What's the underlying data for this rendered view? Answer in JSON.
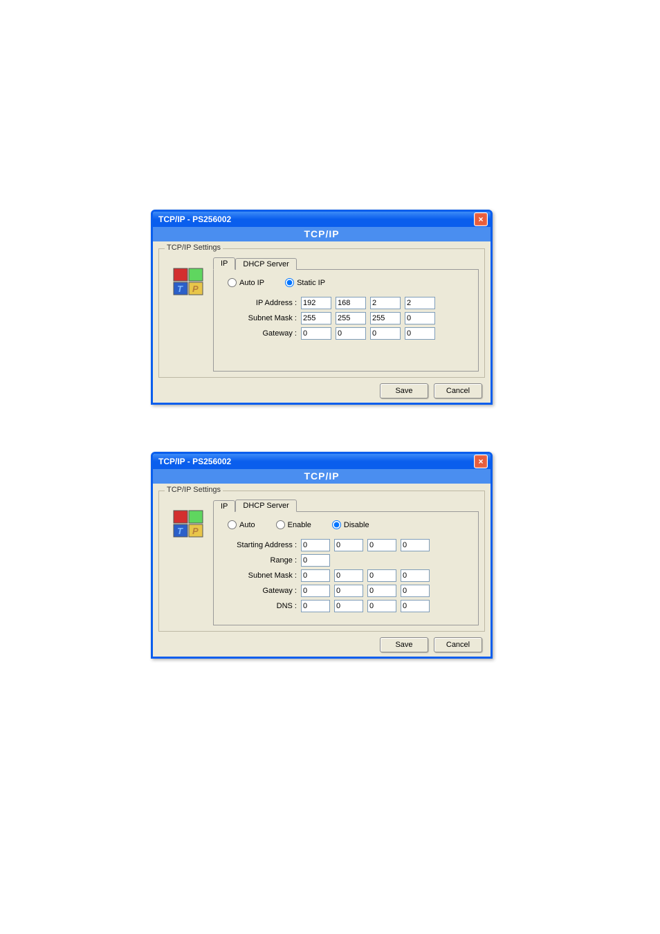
{
  "dialog1": {
    "title": "TCP/IP - PS256002",
    "header": "TCP/IP",
    "group_label": "TCP/IP Settings",
    "tabs": {
      "ip": "IP",
      "dhcp": "DHCP Server"
    },
    "radios": {
      "auto": "Auto IP",
      "static": "Static IP"
    },
    "labels": {
      "ip_address": "IP Address :",
      "subnet": "Subnet Mask :",
      "gateway": "Gateway :"
    },
    "ip": [
      "192",
      "168",
      "2",
      "2"
    ],
    "subnet": [
      "255",
      "255",
      "255",
      "0"
    ],
    "gateway": [
      "0",
      "0",
      "0",
      "0"
    ],
    "buttons": {
      "save": "Save",
      "cancel": "Cancel"
    }
  },
  "dialog2": {
    "title": "TCP/IP - PS256002",
    "header": "TCP/IP",
    "group_label": "TCP/IP Settings",
    "tabs": {
      "ip": "IP",
      "dhcp": "DHCP Server"
    },
    "radios": {
      "auto": "Auto",
      "enable": "Enable",
      "disable": "Disable"
    },
    "labels": {
      "starting": "Starting Address :",
      "range": "Range :",
      "subnet": "Subnet Mask :",
      "gateway": "Gateway :",
      "dns": "DNS :"
    },
    "starting": [
      "0",
      "0",
      "0",
      "0"
    ],
    "range": [
      "0"
    ],
    "subnet": [
      "0",
      "0",
      "0",
      "0"
    ],
    "gateway": [
      "0",
      "0",
      "0",
      "0"
    ],
    "dns": [
      "0",
      "0",
      "0",
      "0"
    ],
    "buttons": {
      "save": "Save",
      "cancel": "Cancel"
    }
  },
  "close_glyph": "×"
}
